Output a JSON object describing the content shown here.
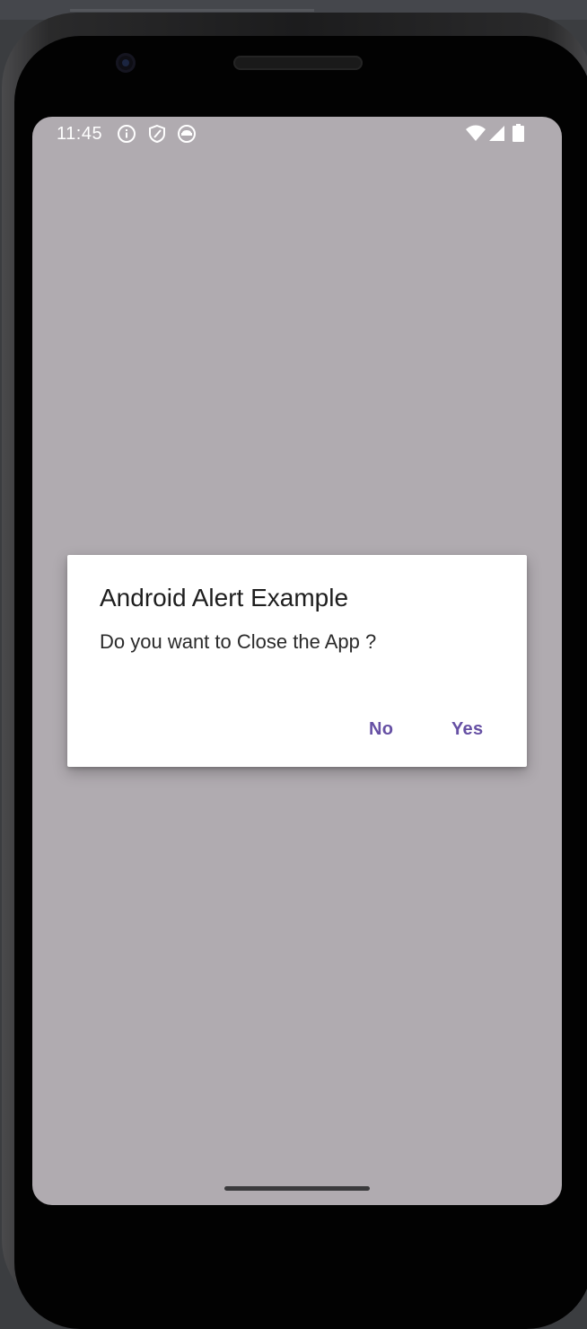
{
  "status_bar": {
    "time": "11:45",
    "left_icons": [
      "info-icon",
      "shield-icon",
      "android-icon"
    ],
    "right_icons": [
      "wifi-icon",
      "cell-signal-icon",
      "battery-icon"
    ]
  },
  "dialog": {
    "title": "Android Alert Example",
    "message": "Do you want to Close the App ?",
    "negative_label": "No",
    "positive_label": "Yes"
  },
  "colors": {
    "scrim_background": "#b0abb0",
    "accent": "#6650a4",
    "dialog_background": "#ffffff"
  }
}
